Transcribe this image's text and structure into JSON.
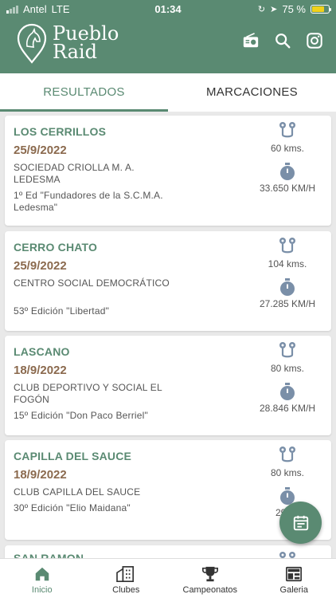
{
  "status": {
    "carrier": "Antel",
    "network": "LTE",
    "time": "01:34",
    "battery": "75 %",
    "battery_level": 0.75
  },
  "header": {
    "title_line1": "Pueblo",
    "title_line2": "Raid",
    "icons": [
      "radio-icon",
      "search-icon",
      "instagram-icon"
    ]
  },
  "tabs": [
    {
      "label": "RESULTADOS",
      "active": true
    },
    {
      "label": "MARCACIONES",
      "active": false
    }
  ],
  "results": [
    {
      "place": "LOS CERRILLOS",
      "date": "25/9/2022",
      "club": "SOCIEDAD CRIOLLA M. A. LEDESMA",
      "edition": "1º Ed \"Fundadores de la S.C.M.A. Ledesma\"",
      "distance": "60 kms.",
      "speed": "33.650 KM/H"
    },
    {
      "place": "CERRO CHATO",
      "date": "25/9/2022",
      "club": "CENTRO SOCIAL DEMOCRÁTICO",
      "edition": "53º Edición \"Libertad\"",
      "distance": "104 kms.",
      "speed": "27.285 KM/H"
    },
    {
      "place": "LASCANO",
      "date": "18/9/2022",
      "club": "CLUB DEPORTIVO Y SOCIAL EL FOGÓN",
      "edition": "15º Edición \"Don Paco Berriel\"",
      "distance": "80 kms.",
      "speed": "28.846 KM/H"
    },
    {
      "place": "CAPILLA DEL SAUCE",
      "date": "18/9/2022",
      "club": "CLUB CAPILLA DEL SAUCE",
      "edition": "30º Edición \"Elio Maidana\"",
      "distance": "80 kms.",
      "speed": "29.81"
    },
    {
      "place": "SAN RAMON",
      "date": "",
      "club": "",
      "edition": "",
      "distance": "",
      "speed": ""
    }
  ],
  "nav": [
    {
      "label": "Inicio",
      "icon": "home-icon",
      "active": true
    },
    {
      "label": "Clubes",
      "icon": "buildings-icon",
      "active": false
    },
    {
      "label": "Campeonatos",
      "icon": "trophy-icon",
      "active": false
    },
    {
      "label": "Galeria",
      "icon": "gallery-icon",
      "active": false
    }
  ],
  "colors": {
    "primary": "#5a8a72",
    "date": "#8b6a4e",
    "icon": "#7a8fa8"
  }
}
